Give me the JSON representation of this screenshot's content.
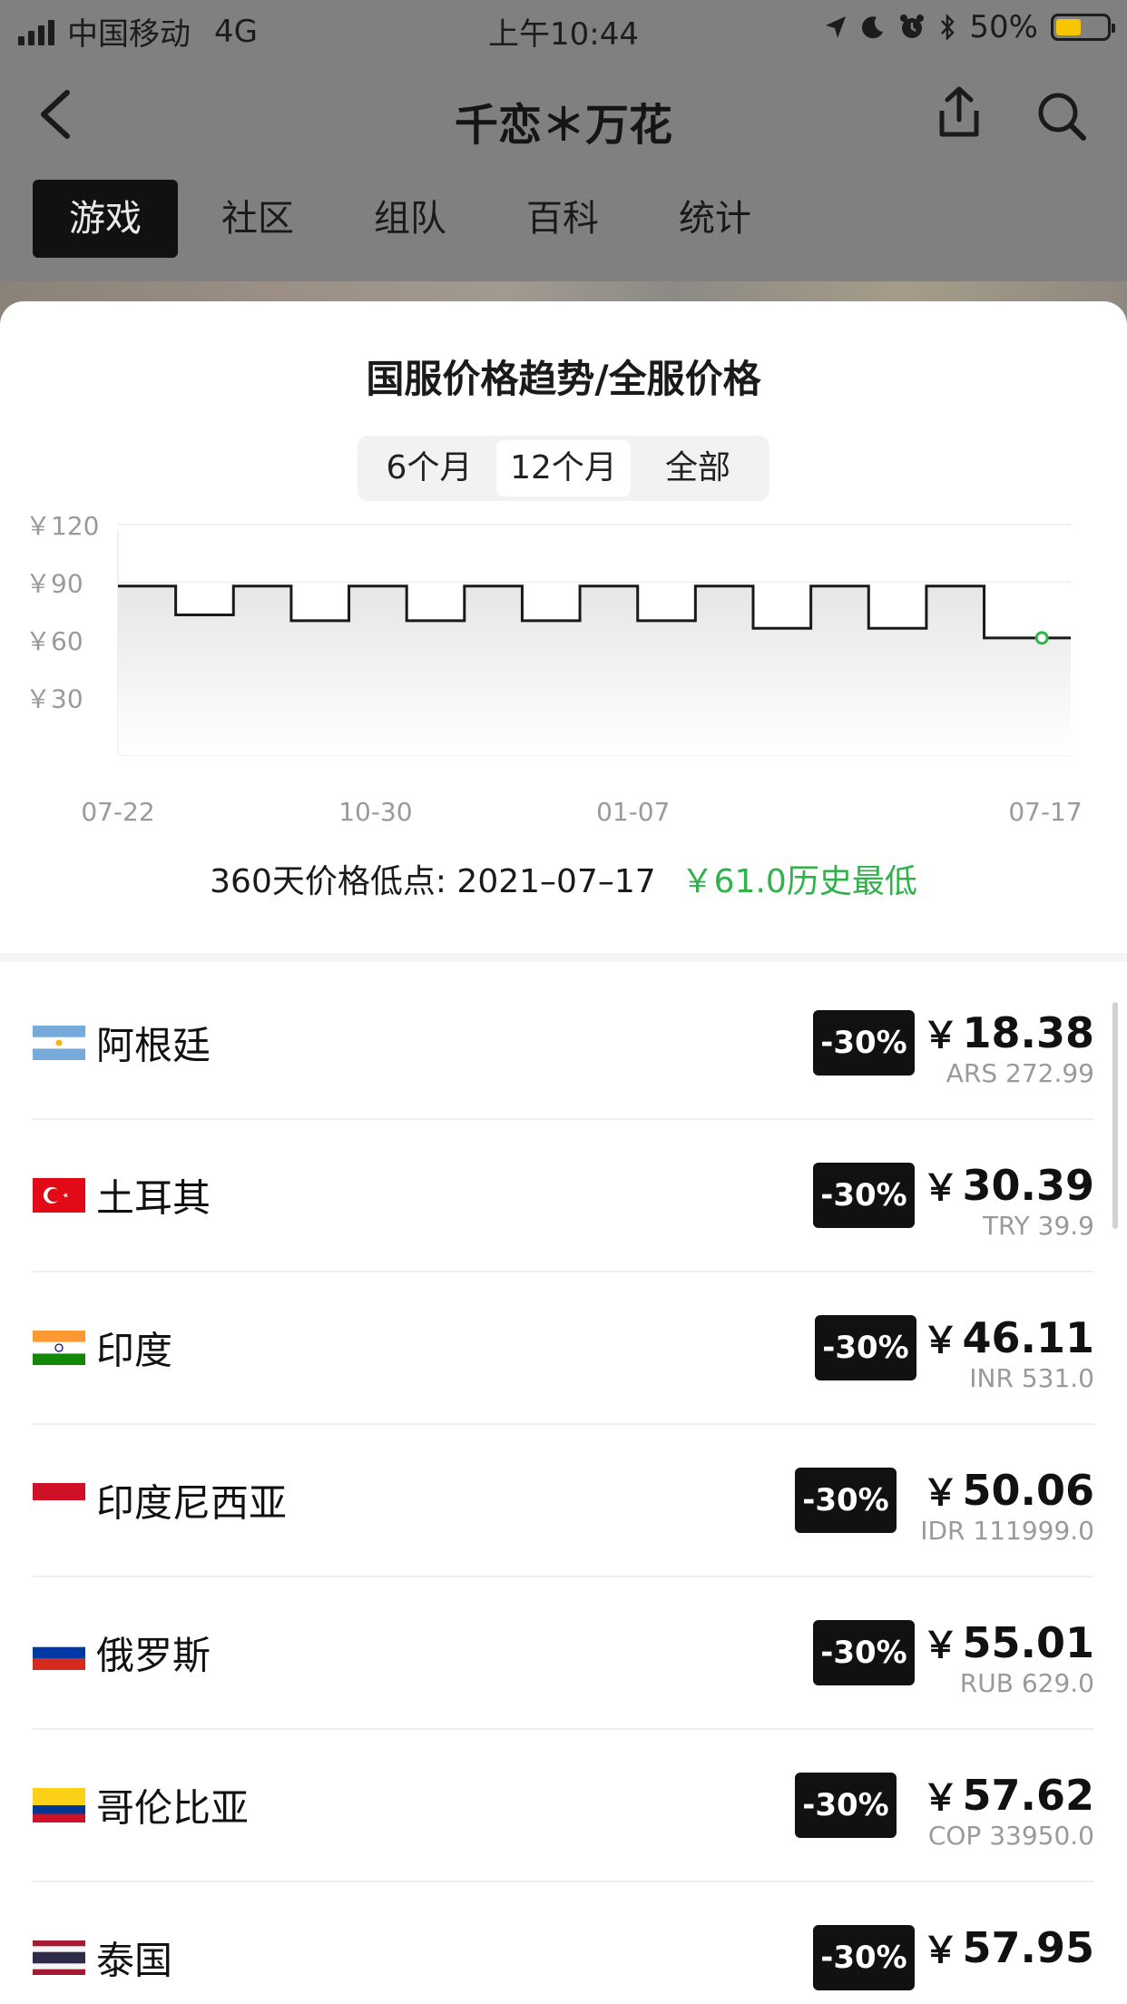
{
  "status_bar": {
    "carrier": "中国移动",
    "network": "4G",
    "time": "上午10:44",
    "battery_percent": "50%",
    "battery_level": 0.5,
    "battery_color": "#f7c600"
  },
  "nav": {
    "title": "千恋＊万花",
    "back_icon": "back-chevron-icon",
    "share_icon": "share-icon",
    "search_icon": "search-icon"
  },
  "tabs": [
    {
      "label": "游戏",
      "active": true
    },
    {
      "label": "社区",
      "active": false
    },
    {
      "label": "组队",
      "active": false
    },
    {
      "label": "百科",
      "active": false
    },
    {
      "label": "统计",
      "active": false
    }
  ],
  "chart_section": {
    "title": "国服价格趋势/全服价格",
    "ranges": [
      {
        "label": "6个月",
        "active": false
      },
      {
        "label": "12个月",
        "active": true
      },
      {
        "label": "全部",
        "active": false
      }
    ],
    "low_text": "360天价格低点: 2021–07–17",
    "low_price_text": "￥61.0历史最低"
  },
  "chart_data": {
    "type": "line",
    "step": true,
    "y_ticks": [
      "￥120",
      "￥90",
      "￥60",
      "￥30"
    ],
    "y_tick_values": [
      120,
      90,
      60,
      30
    ],
    "ylim": [
      0,
      120
    ],
    "x_ticks": [
      "07-22",
      "10-30",
      "01-07",
      "07-17"
    ],
    "x_tick_days": [
      0,
      100,
      200,
      360
    ],
    "xlim_days": [
      0,
      330
    ],
    "points": [
      {
        "day": 0,
        "price": 88
      },
      {
        "day": 20,
        "price": 73
      },
      {
        "day": 40,
        "price": 88
      },
      {
        "day": 60,
        "price": 70
      },
      {
        "day": 80,
        "price": 88
      },
      {
        "day": 100,
        "price": 70
      },
      {
        "day": 120,
        "price": 88
      },
      {
        "day": 140,
        "price": 70
      },
      {
        "day": 160,
        "price": 88
      },
      {
        "day": 180,
        "price": 70
      },
      {
        "day": 200,
        "price": 88
      },
      {
        "day": 220,
        "price": 66
      },
      {
        "day": 240,
        "price": 88
      },
      {
        "day": 260,
        "price": 66
      },
      {
        "day": 280,
        "price": 88
      },
      {
        "day": 300,
        "price": 61
      },
      {
        "day": 330,
        "price": 61
      }
    ],
    "highlight_point": {
      "day": 320,
      "price": 61
    },
    "line_color": "#1a1a1a",
    "highlight_color": "#2fb24a",
    "grid": true
  },
  "prices": [
    {
      "country": "阿根廷",
      "flag": "argentina-flag-icon",
      "discount": "-30%",
      "cny": "18.38",
      "local": "ARS 272.99"
    },
    {
      "country": "土耳其",
      "flag": "turkey-flag-icon",
      "discount": "-30%",
      "cny": "30.39",
      "local": "TRY 39.9"
    },
    {
      "country": "印度",
      "flag": "india-flag-icon",
      "discount": "-30%",
      "cny": "46.11",
      "local": "INR 531.0"
    },
    {
      "country": "印度尼西亚",
      "flag": "indonesia-flag-icon",
      "discount": "-30%",
      "cny": "50.06",
      "local": "IDR 111999.0"
    },
    {
      "country": "俄罗斯",
      "flag": "russia-flag-icon",
      "discount": "-30%",
      "cny": "55.01",
      "local": "RUB 629.0"
    },
    {
      "country": "哥伦比亚",
      "flag": "colombia-flag-icon",
      "discount": "-30%",
      "cny": "57.62",
      "local": "COP 33950.0"
    },
    {
      "country": "泰国",
      "flag": "thailand-flag-icon",
      "discount": "-30%",
      "cny": "57.95",
      "local": ""
    }
  ],
  "currency_symbol": "￥"
}
